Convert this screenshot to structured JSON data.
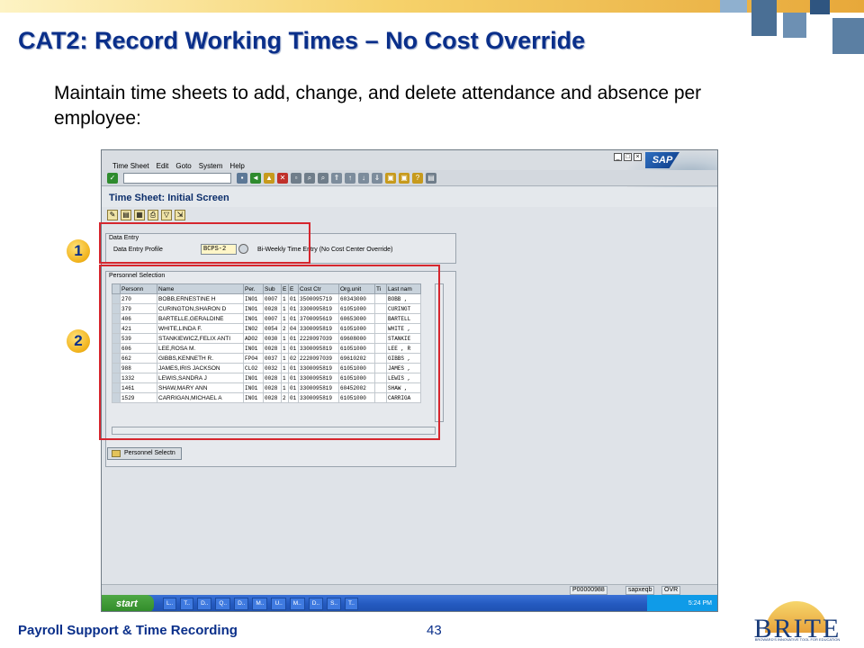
{
  "slide": {
    "title": "CAT2: Record Working Times – No Cost Override",
    "body": "Maintain time sheets to add, change, and delete attendance and absence per employee:",
    "footer_left": "Payroll Support & Time Recording",
    "page_number": "43",
    "logo_text": "BRITE",
    "logo_tagline": "BROWARD'S INNOVATIVE TOOL FOR EDUCATION",
    "callouts": [
      "1",
      "2"
    ],
    "accent_color": "#0a2f8a",
    "highlight_color": "#d6262e"
  },
  "sap": {
    "menu": [
      "Time Sheet",
      "Edit",
      "Goto",
      "System",
      "Help"
    ],
    "logo": "SAP",
    "screen_title": "Time Sheet: Initial Screen",
    "data_entry": {
      "group_label": "Data Entry",
      "profile_label": "Data Entry Profile",
      "profile_value": "BCPS-2",
      "profile_desc": "Bi-Weekly Time Entry (No Cost Center Override)"
    },
    "personnel": {
      "group_label": "Personnel Selection",
      "columns": [
        "Personn",
        "Name",
        "Per.",
        "Sub",
        "E",
        "E",
        "Cost Ctr",
        "Org.unit",
        "Ti",
        "Last nam"
      ],
      "rows": [
        [
          "270",
          "BOBB,ERNESTINE H",
          "IN01",
          "0007",
          "1",
          "01",
          "3500095719",
          "60343000",
          "",
          "BOBB ,"
        ],
        [
          "379",
          "CURINGTON,SHARON D",
          "IN01",
          "0028",
          "1",
          "01",
          "3300095819",
          "61051000",
          "",
          "CURINGT"
        ],
        [
          "406",
          "BARTELLE,GERALDINE",
          "IN01",
          "0007",
          "1",
          "01",
          "3700095619",
          "60653000",
          "",
          "BARTELL"
        ],
        [
          "421",
          "WHITE,LINDA F.",
          "IN02",
          "0054",
          "2",
          "04",
          "3300095819",
          "61051000",
          "",
          "WHITE ,"
        ],
        [
          "539",
          "STANKIEWICZ,FELIX ANTI",
          "AD02",
          "0030",
          "1",
          "01",
          "2220097039",
          "69608000",
          "",
          "STANKIE"
        ],
        [
          "606",
          "LEE,ROSA M.",
          "IN01",
          "0028",
          "1",
          "01",
          "3300095819",
          "61051000",
          "",
          "LEE , R"
        ],
        [
          "662",
          "GIBBS,KENNETH R.",
          "FP04",
          "0037",
          "1",
          "02",
          "2220097039",
          "69610202",
          "",
          "GIBBS ,"
        ],
        [
          "988",
          "JAMES,IRIS JACKSON",
          "CL02",
          "0032",
          "1",
          "01",
          "3300095819",
          "61051000",
          "",
          "JAMES ,"
        ],
        [
          "1332",
          "LEWIS,SANDRA J",
          "IN01",
          "0028",
          "1",
          "01",
          "3300095819",
          "61051000",
          "",
          "LEWIS ,"
        ],
        [
          "1461",
          "SHAW,MARY ANN",
          "IN01",
          "0028",
          "1",
          "01",
          "3300095819",
          "60452002",
          "",
          "SHAW ,"
        ],
        [
          "1529",
          "CARRIGAN,MICHAEL A",
          "IN01",
          "0028",
          "2",
          "01",
          "3300095819",
          "61051000",
          "",
          "CARRIGA"
        ]
      ],
      "button_label": "Personnel Selectn"
    },
    "status": {
      "session": "P00000988",
      "server": "sapxeqb",
      "mode": "OVR"
    },
    "taskbar": {
      "start_label": "start",
      "items": [
        "L..",
        "T..",
        "D..",
        "Q..",
        "D..",
        "M..",
        "U..",
        "M..",
        "D..",
        "S..",
        "T.."
      ],
      "clock": "5:24 PM"
    }
  }
}
